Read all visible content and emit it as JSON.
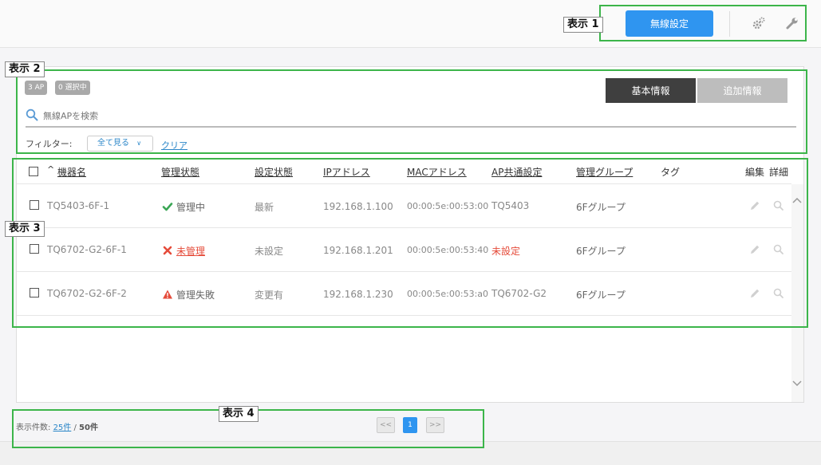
{
  "callouts": {
    "c1": "表示 1",
    "c2": "表示 2",
    "c3": "表示 3",
    "c4": "表示 4"
  },
  "toolbar": {
    "wireless_settings": "無線設定",
    "settings_icon": "gears-icon",
    "tools_icon": "wrench-icon"
  },
  "summary": {
    "ap_count": "3 AP",
    "selected": "0 選択中"
  },
  "view_tabs": {
    "basic": "基本情報",
    "extra": "追加情報"
  },
  "search": {
    "placeholder": "無線APを検索"
  },
  "filter": {
    "label": "フィルター:",
    "selected": "全て見る",
    "clear": "クリア"
  },
  "table": {
    "headers": {
      "sort_indicator": "^",
      "device_name": "機器名",
      "mgmt_status": "管理状態",
      "config_status": "設定状態",
      "ip": "IPアドレス",
      "mac": "MACアドレス",
      "ap_common": "AP共通設定",
      "group": "管理グループ",
      "tag": "タグ",
      "edit": "編集",
      "detail": "詳細"
    },
    "rows": [
      {
        "name": "TQ5403-6F-1",
        "mgmt_status": "管理中",
        "status_icon": "check-icon",
        "config": "最新",
        "ip": "192.168.1.100",
        "mac": "00:00:5e:00:53:00",
        "ap_common": "TQ5403",
        "group": "6Fグループ"
      },
      {
        "name": "TQ6702-G2-6F-1",
        "mgmt_status": "未管理",
        "status_icon": "cross-icon",
        "config": "未設定",
        "ip": "192.168.1.201",
        "mac": "00:00:5e:00:53:40",
        "ap_common": "未設定",
        "group": "6Fグループ"
      },
      {
        "name": "TQ6702-G2-6F-2",
        "mgmt_status": "管理失敗",
        "status_icon": "warning-icon",
        "config": "変更有",
        "ip": "192.168.1.230",
        "mac": "00:00:5e:00:53:a0",
        "ap_common": "TQ6702-G2",
        "group": "6Fグループ"
      }
    ]
  },
  "pagination": {
    "label": "表示件数:",
    "per_page": "25件",
    "separator": "/",
    "total": "50件",
    "prev": "<<",
    "current": "1",
    "next": ">>"
  },
  "colors": {
    "accent": "#2f95f0",
    "highlight_box": "#3cb54a",
    "success": "#3aa655",
    "error": "#e54b3a"
  }
}
